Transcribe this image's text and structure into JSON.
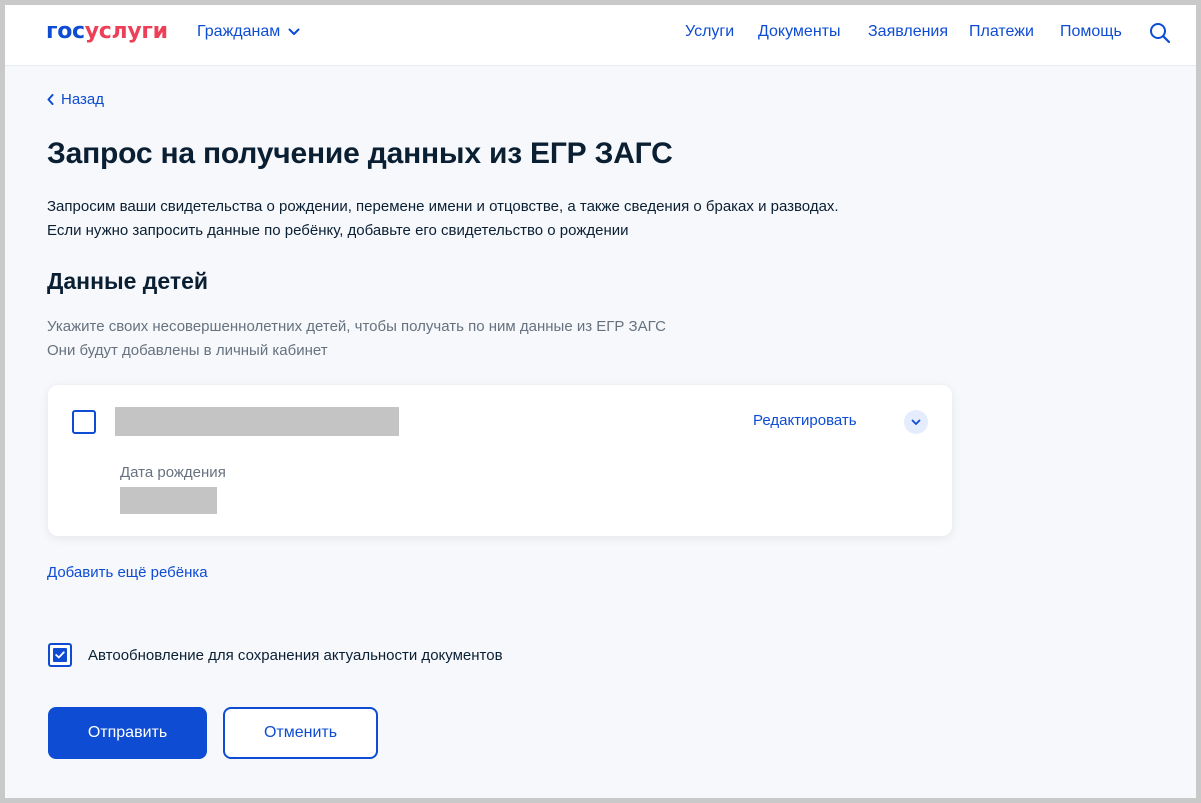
{
  "header": {
    "logo_part1": "гос",
    "logo_part2": "услуги",
    "audience": "Гражданам",
    "nav": [
      "Услуги",
      "Документы",
      "Заявления",
      "Платежи",
      "Помощь"
    ]
  },
  "back_label": "Назад",
  "title": "Запрос на получение данных из ЕГР ЗАГС",
  "intro": [
    "Запросим ваши свидетельства о рождении, перемене имени и отцовстве, а также сведения о браках и разводах.",
    "Если нужно запросить данные по ребёнку, добавьте его свидетельство о рождении"
  ],
  "children_section": {
    "title": "Данные детей",
    "hint": [
      "Укажите своих несовершеннолетних детей, чтобы получать по ним данные из ЕГР ЗАГС",
      "Они будут добавлены в личный кабинет"
    ],
    "child_card": {
      "checked": false,
      "edit_label": "Редактировать",
      "dob_label": "Дата рождения"
    },
    "add_child_label": "Добавить ещё ребёнка"
  },
  "auto_update": {
    "checked": true,
    "label": "Автообновление для сохранения актуальности документов"
  },
  "actions": {
    "submit_label": "Отправить",
    "cancel_label": "Отменить"
  },
  "colors": {
    "accent": "#0d4cd3",
    "logo_red": "#ee3f58",
    "text": "#0b1f33",
    "muted": "#66727f",
    "background": "#f6f8fb"
  }
}
